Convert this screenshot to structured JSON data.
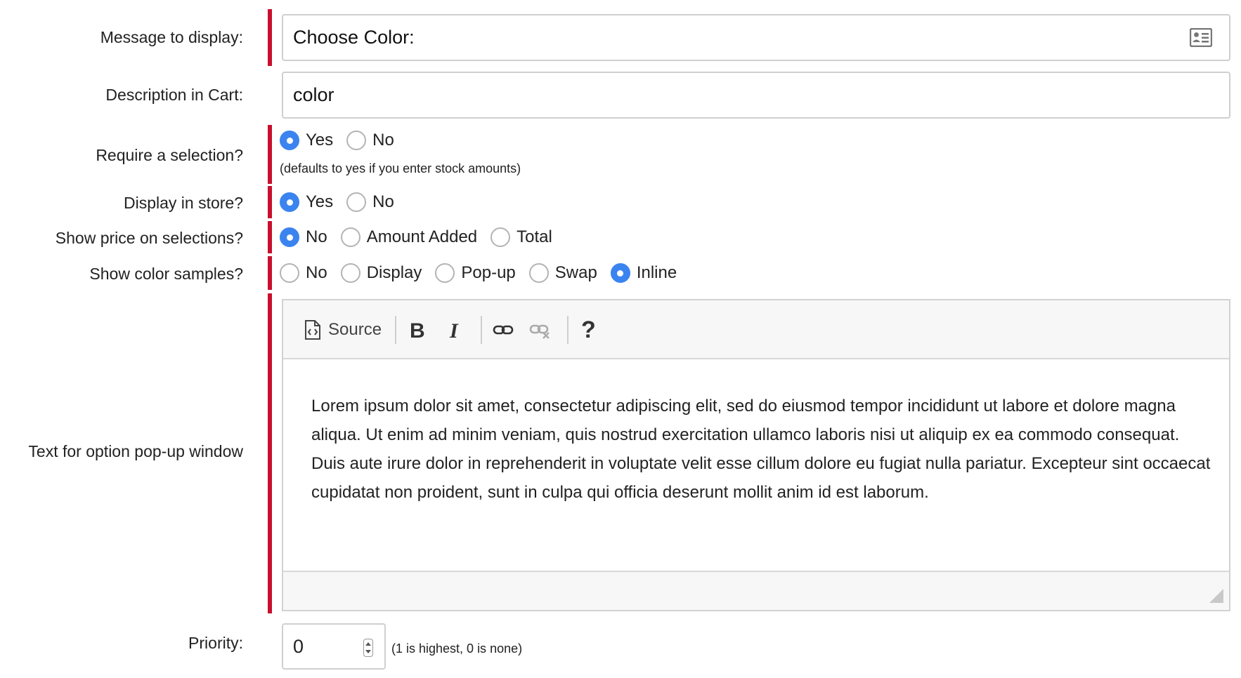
{
  "fields": {
    "message": {
      "label": "Message to display:",
      "value": "Choose Color:"
    },
    "description": {
      "label": "Description in Cart:",
      "value": "color"
    },
    "require": {
      "label": "Require a selection?",
      "options": [
        "Yes",
        "No"
      ],
      "selected": "Yes",
      "hint": "(defaults to yes if you enter stock amounts)"
    },
    "display_store": {
      "label": "Display in store?",
      "options": [
        "Yes",
        "No"
      ],
      "selected": "Yes"
    },
    "show_price": {
      "label": "Show price on selections?",
      "options": [
        "No",
        "Amount Added",
        "Total"
      ],
      "selected": "No"
    },
    "color_samples": {
      "label": "Show color samples?",
      "options": [
        "No",
        "Display",
        "Pop-up",
        "Swap",
        "Inline"
      ],
      "selected": "Inline"
    },
    "popup_text": {
      "label": "Text for option pop-up window",
      "toolbar": {
        "source_label": "Source",
        "help_label": "?"
      },
      "body": "Lorem ipsum dolor sit amet, consectetur adipiscing elit, sed do eiusmod tempor incididunt ut labore et dolore magna aliqua. Ut enim ad minim veniam, quis nostrud exercitation ullamco laboris nisi ut aliquip ex ea commodo consequat. Duis aute irure dolor in reprehenderit in voluptate velit esse cillum dolore eu fugiat nulla pariatur. Excepteur sint occaecat cupidatat non proident, sunt in culpa qui officia deserunt mollit anim id est laborum."
    },
    "priority": {
      "label": "Priority:",
      "value": "0",
      "hint": "(1 is highest, 0 is none)"
    }
  },
  "colors": {
    "required_bar": "#c8102e",
    "radio_checked": "#3b84f0"
  }
}
